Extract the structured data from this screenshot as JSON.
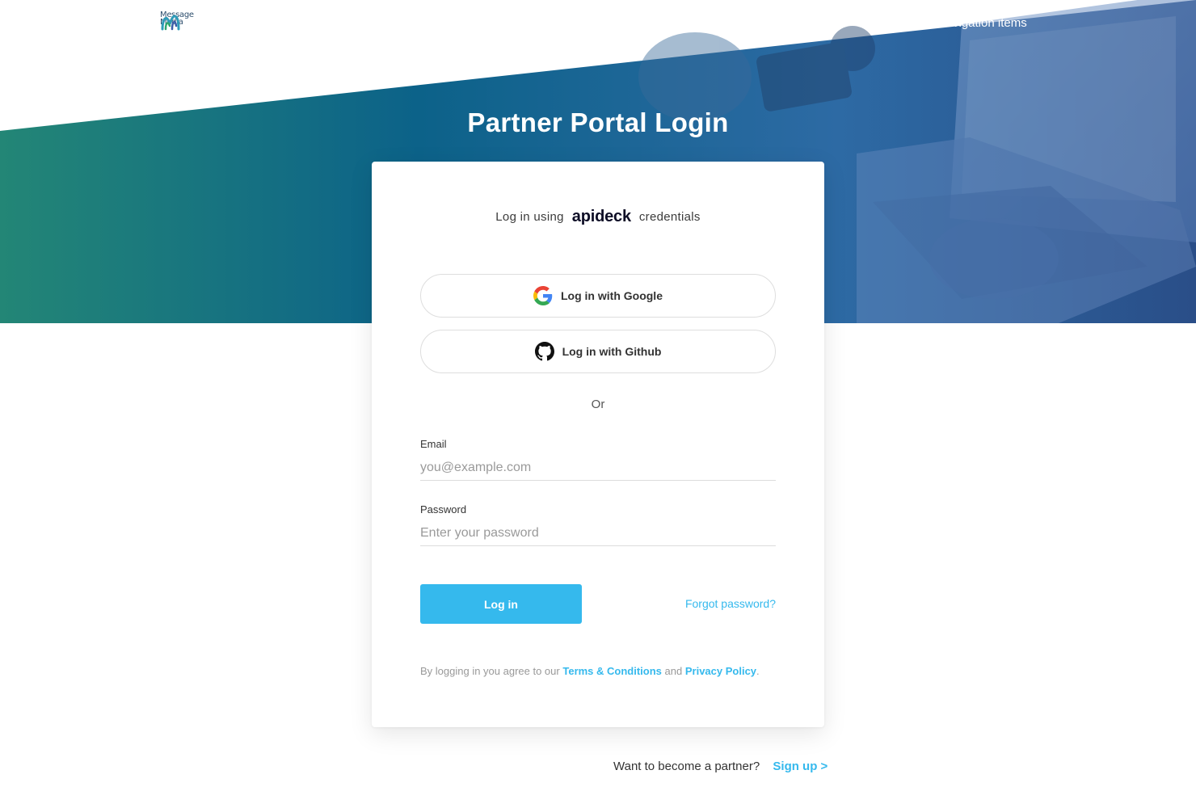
{
  "header": {
    "logo_line1": "Message",
    "logo_line2": "Media",
    "nav_add": "+ Add your navigation items"
  },
  "hero": {
    "title": "Partner Portal Login"
  },
  "card": {
    "intro_prefix": "Log in using",
    "intro_brand": "apideck",
    "intro_suffix": "credentials",
    "google_label": "Log in with Google",
    "github_label": "Log in with Github",
    "or_label": "Or",
    "email": {
      "label": "Email",
      "placeholder": "you@example.com",
      "value": ""
    },
    "password": {
      "label": "Password",
      "placeholder": "Enter your password",
      "value": ""
    },
    "login_label": "Log in",
    "forgot_label": "Forgot password?",
    "legal": {
      "prefix": "By logging in you agree to our",
      "terms": "Terms & Conditions",
      "and": "and",
      "privacy": "Privacy Policy",
      "suffix": "."
    }
  },
  "footer": {
    "prompt": "Want to become a partner?",
    "signup": "Sign up  >"
  },
  "colors": {
    "accent": "#35b9ed",
    "hero_start": "#1f8a7c",
    "hero_end": "#2a5a9c"
  }
}
